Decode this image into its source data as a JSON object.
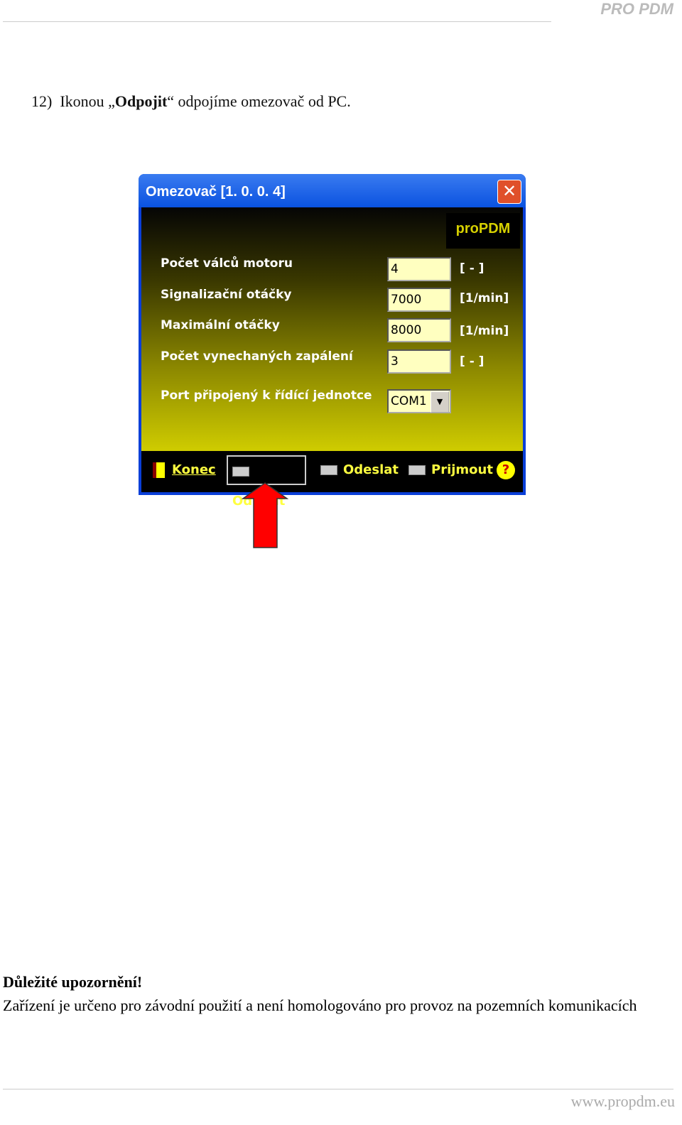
{
  "header": {
    "logo": "PRO PDM"
  },
  "step": {
    "number": "12)",
    "pre": "Ikonou „",
    "bold": "Odpojit",
    "post": "“ odpojíme omezovač od PC."
  },
  "dialog": {
    "title": "Omezovač  [1. 0. 0. 4]",
    "logo": "proPDM",
    "fields": [
      {
        "label": "Počet válců motoru",
        "value": "4",
        "unit": "[   -   ]"
      },
      {
        "label": "Signalizační otáčky",
        "value": "7000",
        "unit": "[1/min]"
      },
      {
        "label": "Maximální otáčky",
        "value": "8000",
        "unit": "[1/min]"
      },
      {
        "label": "Počet vynechaných zapálení",
        "value": "3",
        "unit": "[   -   ]"
      }
    ],
    "port": {
      "label": "Port připojený k řídící jednotce",
      "value": "COM1"
    },
    "buttons": {
      "konec": "Konec",
      "odpojit": "Odpojit",
      "odeslat": "Odeslat",
      "prijmout": "Prijmout",
      "help": "?"
    }
  },
  "warning": {
    "title": "Důležité upozornění!",
    "text": "Zařízení je určeno pro závodní použití a není homologováno pro provoz na pozemních komunikacích"
  },
  "footer": {
    "url": "www.propdm.eu"
  }
}
